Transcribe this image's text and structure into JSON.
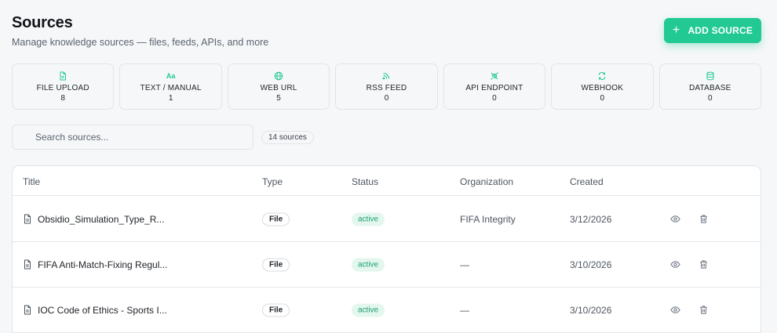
{
  "header": {
    "title": "Sources",
    "subtitle": "Manage knowledge sources — files, feeds, APIs, and more",
    "add_button": "ADD SOURCE"
  },
  "source_types": [
    {
      "label": "FILE UPLOAD",
      "count": "8",
      "icon": "file-icon"
    },
    {
      "label": "TEXT / MANUAL",
      "count": "1",
      "icon": "text-icon"
    },
    {
      "label": "WEB URL",
      "count": "5",
      "icon": "globe-icon"
    },
    {
      "label": "RSS FEED",
      "count": "0",
      "icon": "rss-icon"
    },
    {
      "label": "API ENDPOINT",
      "count": "0",
      "icon": "plug-icon"
    },
    {
      "label": "WEBHOOK",
      "count": "0",
      "icon": "refresh-icon"
    },
    {
      "label": "DATABASE",
      "count": "0",
      "icon": "database-icon"
    }
  ],
  "text_icon_glyph": "Aa",
  "search": {
    "placeholder": "Search sources...",
    "value": ""
  },
  "count_label": "14 sources",
  "table": {
    "columns": [
      "Title",
      "Type",
      "Status",
      "Organization",
      "Created"
    ],
    "rows": [
      {
        "title": "Obsidio_Simulation_Type_R...",
        "type": "File",
        "status": "active",
        "organization": "FIFA Integrity",
        "created": "3/12/2026"
      },
      {
        "title": "FIFA Anti-Match-Fixing Regul...",
        "type": "File",
        "status": "active",
        "organization": "—",
        "created": "3/10/2026"
      },
      {
        "title": "IOC Code of Ethics - Sports I...",
        "type": "File",
        "status": "active",
        "organization": "—",
        "created": "3/10/2026"
      }
    ]
  },
  "colors": {
    "accent": "#22c993",
    "status_active_bg": "#e3f7ee",
    "status_active_text": "#1e9f6e"
  }
}
